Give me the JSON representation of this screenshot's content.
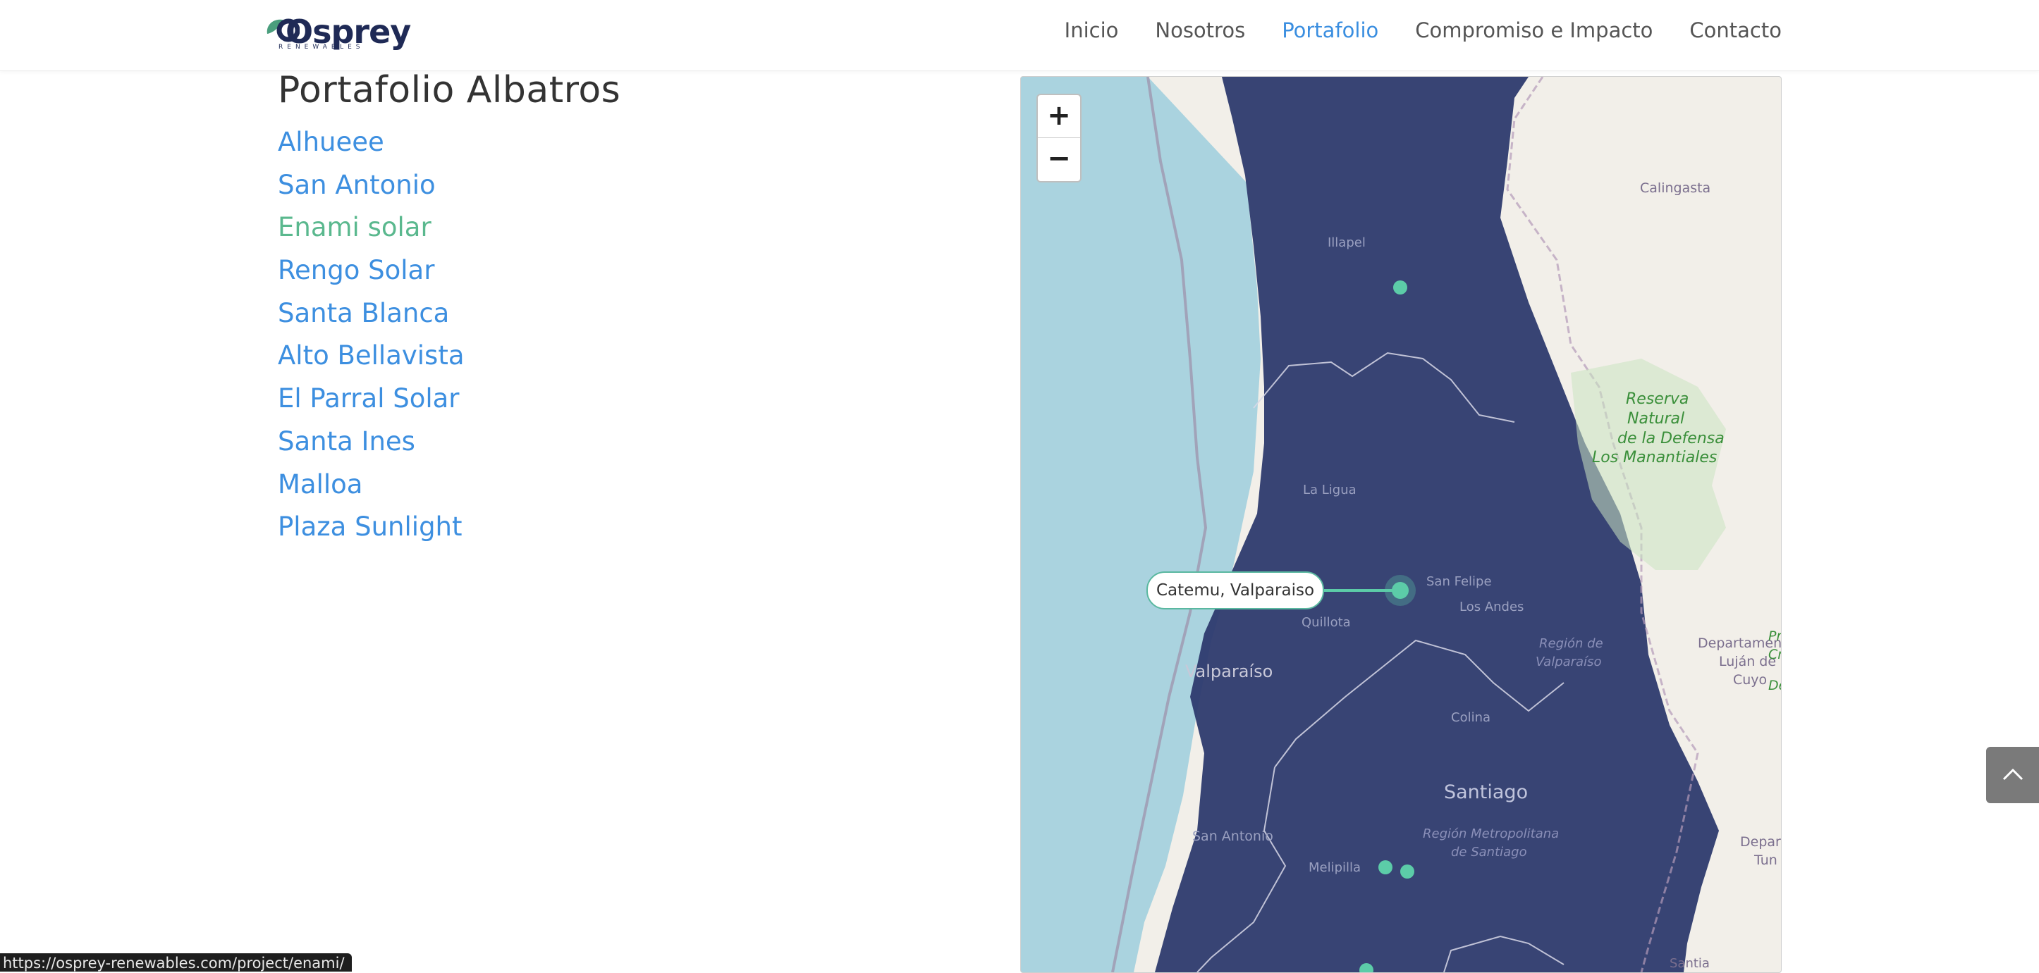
{
  "brand": {
    "name": "Osprey",
    "tagline": "RENEWABLES",
    "colors": {
      "navy": "#1f2a56",
      "teal": "#4a9e7d",
      "link": "#3d8fe0",
      "link_active": "#5ab88e"
    }
  },
  "nav": {
    "items": [
      {
        "label": "Inicio"
      },
      {
        "label": "Nosotros"
      },
      {
        "label": "Portafolio",
        "active": true
      },
      {
        "label": "Compromiso e Impacto"
      },
      {
        "label": "Contacto"
      }
    ]
  },
  "page": {
    "title": "Portafolio Albatros"
  },
  "projects": [
    {
      "label": "Alhueee"
    },
    {
      "label": "San Antonio"
    },
    {
      "label": "Enami solar",
      "hovered": true
    },
    {
      "label": "Rengo Solar"
    },
    {
      "label": "Santa Blanca"
    },
    {
      "label": "Alto Bellavista"
    },
    {
      "label": "El Parral Solar"
    },
    {
      "label": "Santa Ines"
    },
    {
      "label": "Malloa"
    },
    {
      "label": "Plaza Sunlight"
    }
  ],
  "map": {
    "zoom_in": "+",
    "zoom_out": "−",
    "popup": "Catemu, Valparaiso",
    "labels": {
      "illapel": "Illapel",
      "calingasta": "Calingasta",
      "reserva1": "Reserva",
      "reserva2": "Natural",
      "reserva3": "de la Defensa",
      "reserva4": "Los Manantiales",
      "la_ligua": "La Ligua",
      "san_felipe": "San Felipe",
      "los_andes": "Los Andes",
      "quillota": "Quillota",
      "region_valpo1": "Región de",
      "region_valpo2": "Valparaíso",
      "valparaiso": "Valparaíso",
      "depto1": "Departamento",
      "depto2": "Luján de",
      "depto3": "Cuyo",
      "colina": "Colina",
      "santiago": "Santiago",
      "region_rm1": "Región Metropolitana",
      "region_rm2": "de Santiago",
      "san_antonio": "San Antonio",
      "melipilla": "Melipilla",
      "depa": "Depar",
      "tun": "Tun",
      "edge_p": "Pr",
      "edge_c": "Cr",
      "edge_d": "De",
      "santiago_bottom": "Santia"
    },
    "colors": {
      "sea": "#aad3df",
      "land": "#f2efe9",
      "overlay": "#2d3a6e",
      "marker": "#5ccca8"
    }
  },
  "status_bar": {
    "url": "https://osprey-renewables.com/project/enami/"
  }
}
